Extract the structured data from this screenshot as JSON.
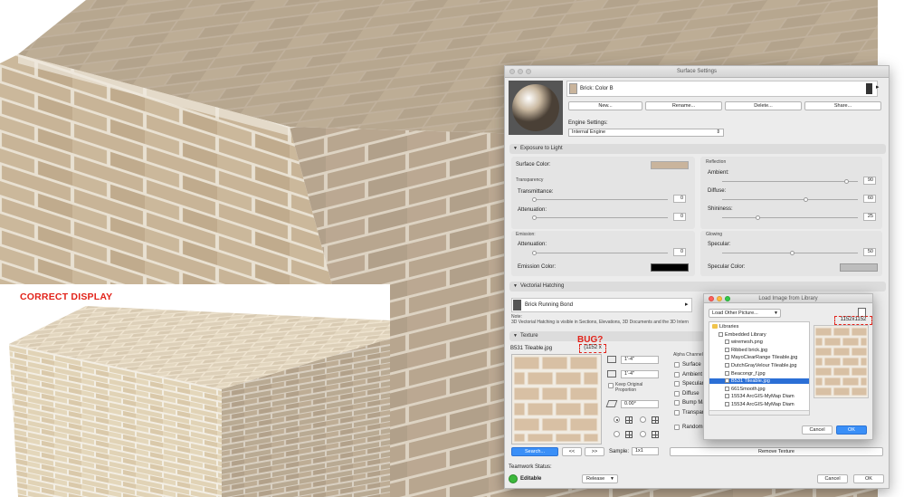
{
  "inset_label": "CORRECT DISPLAY",
  "bug_label": "BUG?",
  "bug_size": "(1152 x",
  "main_dialog": {
    "title": "Surface Settings",
    "surface_name": "Brick: Color B",
    "buttons": {
      "new": "New...",
      "rename": "Rename...",
      "delete": "Delete...",
      "share": "Share..."
    },
    "engine_settings_label": "Engine Settings:",
    "engine_value": "Internal Engine",
    "exposure": {
      "title": "Exposure to Light",
      "surface_color_label": "Surface Color:",
      "surface_color": "#c9b49c",
      "transparency_label": "Transparency",
      "transmittance_label": "Transmittance:",
      "transmittance_value": "0",
      "attenuation_label": "Attenuation:",
      "attenuation_value": "0",
      "reflection_label": "Reflection",
      "ambient_label": "Ambient:",
      "ambient_value": "90",
      "diffuse_label": "Diffuse:",
      "diffuse_value": "60",
      "shininess_label": "Shininess:",
      "shininess_value": "25",
      "emission_label": "Emission:",
      "emission_attenuation_label": "Attenuation:",
      "emission_attenuation_value": "0",
      "emission_color_label": "Emission Color:",
      "emission_color": "#000000",
      "glowing_label": "Glowing",
      "specular_label": "Specular:",
      "specular_value": "50",
      "specular_color_label": "Specular Color:",
      "specular_color": "#bdbdbd"
    },
    "hatching": {
      "title": "Vectorial Hatching",
      "pattern_name": "Brick Running Bond",
      "note_label": "Note:",
      "note_text": "3D Vectorial Hatching is visible in Sections, Elevations, 3D Documents and the 3D Intern"
    },
    "texture": {
      "title": "Texture",
      "file_name": "B531 Tileable.jpg",
      "width_value": "1'-4\"",
      "height_value": "1'-4\"",
      "keep_proportion_label": "Keep Original Proportion",
      "angle_value": "0.00°",
      "alpha_channel_label": "Alpha Channel",
      "alpha_items": [
        "Surface",
        "Ambient",
        "Specular",
        "Diffuse",
        "Bump Map",
        "Transparency"
      ],
      "random_label": "Random",
      "search_label": "Search...",
      "prev_label": "<<",
      "next_label": ">>",
      "sample_label": "Sample:",
      "sample_value": "1x1",
      "remove_label": "Remove Texture"
    },
    "teamwork_label": "Teamwork Status:",
    "editable_label": "Editable",
    "release_label": "Release",
    "cancel_label": "Cancel",
    "ok_label": "OK"
  },
  "load_dialog": {
    "title": "Load Image from Library",
    "load_other_label": "Load Other Picture...",
    "dims_label": "1152x1152",
    "tree": [
      {
        "label": "Libraries",
        "kind": "folder",
        "indent": 0
      },
      {
        "label": "Embedded Library",
        "kind": "lib",
        "indent": 1
      },
      {
        "label": "wiremesh.png",
        "kind": "file",
        "indent": 2
      },
      {
        "label": "Ribbed brick.jpg",
        "kind": "file",
        "indent": 2
      },
      {
        "label": "MayoClearRange Tileable.jpg",
        "kind": "file",
        "indent": 2
      },
      {
        "label": "DutchGrayVelour Tileable.jpg",
        "kind": "file",
        "indent": 2
      },
      {
        "label": "Beacongr_f.jpg",
        "kind": "file",
        "indent": 2
      },
      {
        "label": "B531 Tileable.jpg",
        "kind": "file",
        "indent": 2,
        "selected": true
      },
      {
        "label": "661Smooth.jpg",
        "kind": "file",
        "indent": 2
      },
      {
        "label": "15534 ArcGIS-MyMap Diam",
        "kind": "file",
        "indent": 2
      },
      {
        "label": "15534 ArcGIS-MyMap Diam",
        "kind": "file",
        "indent": 2
      }
    ],
    "cancel_label": "Cancel",
    "ok_label": "OK"
  },
  "colors": {
    "accent_red": "#e2231a",
    "button_blue": "#3a8ff7",
    "selection_blue": "#2b6fd6"
  }
}
